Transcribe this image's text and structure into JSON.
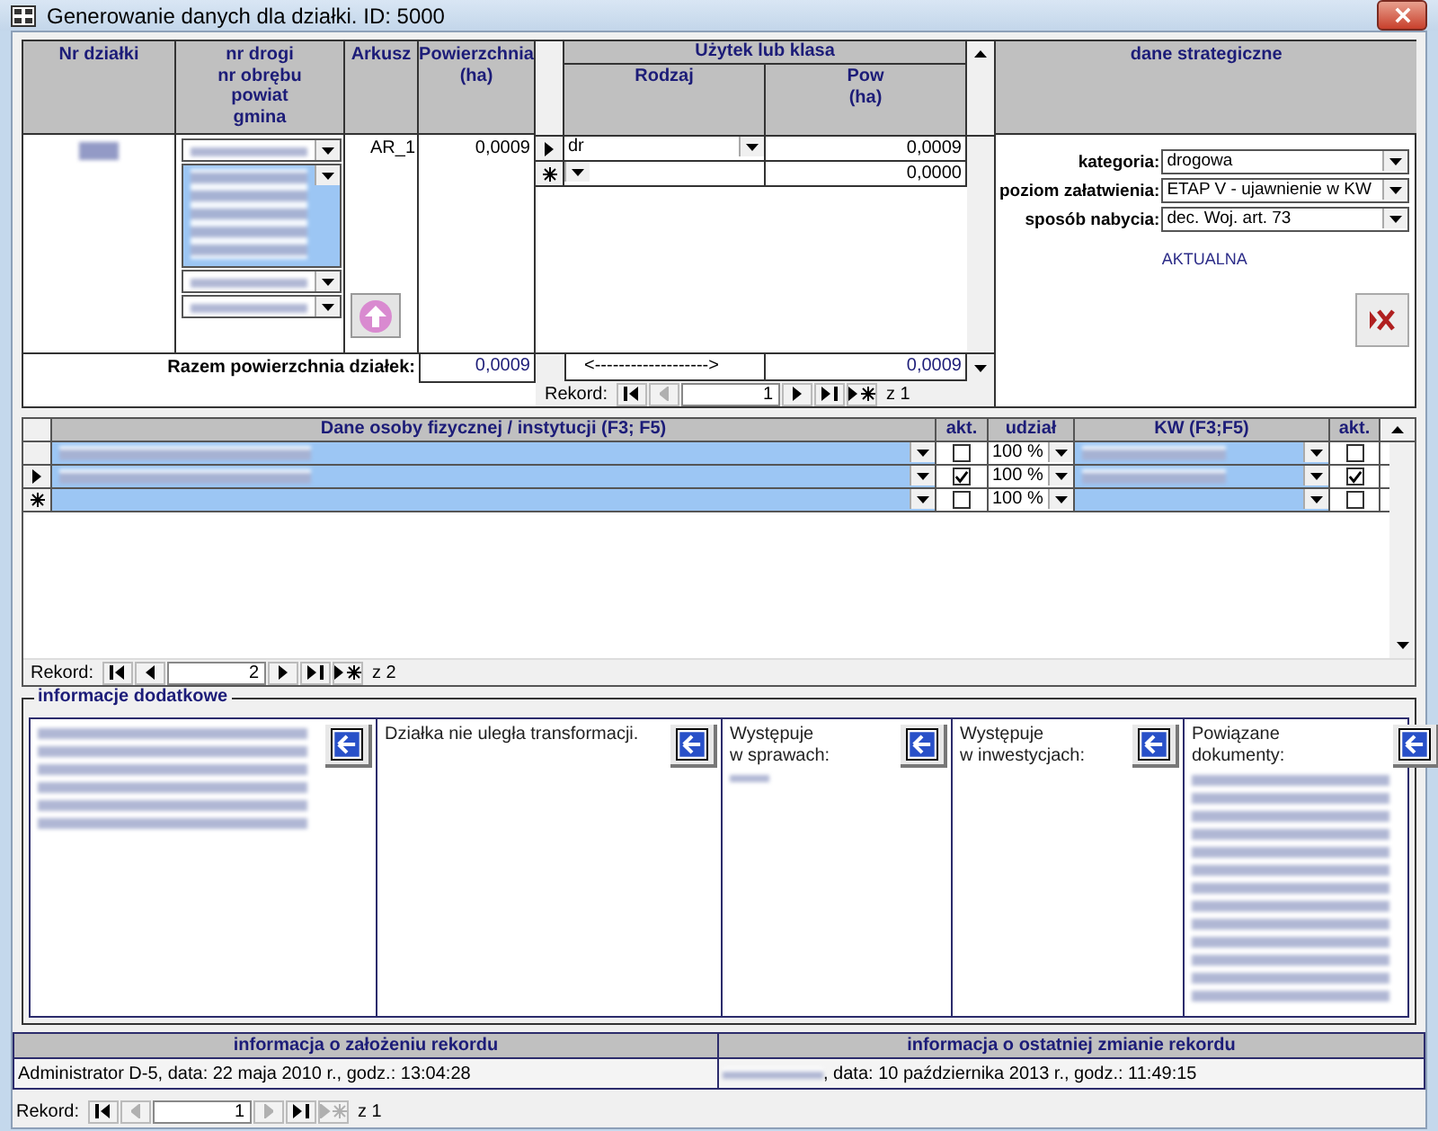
{
  "window": {
    "title": "Generowanie danych dla działki. ID: 5000"
  },
  "parcel": {
    "columns": [
      "Nr działki",
      "nr drogi\nnr obrębu\npowiat\ngmina",
      "Arkusz",
      "Powierzchnia\n(ha)"
    ],
    "number_redacted": true,
    "combos": [
      {
        "multiline": false,
        "selected": false
      },
      {
        "multiline": true,
        "selected": true
      },
      {
        "multiline": false,
        "selected": false
      },
      {
        "multiline": false,
        "selected": false
      }
    ],
    "arkusz": "AR_1",
    "area": "0,0009",
    "total": {
      "label": "Razem powierzchnia działek:",
      "value": "0,0009"
    }
  },
  "land_use": {
    "title": "Użytek lub klasa",
    "columns": [
      "Rodzaj",
      "Pow\n(ha)"
    ],
    "rows": [
      {
        "kind": "current",
        "rodzaj": "dr",
        "pow": "0,0009"
      },
      {
        "kind": "new",
        "pow": "0,0000"
      }
    ],
    "total_arrow": "<------------------->",
    "total": "0,0009",
    "nav": {
      "label": "Rekord:",
      "current": "1",
      "count": "z 1",
      "buttons": [
        {
          "kind": "first",
          "disabled": false
        },
        {
          "kind": "prev",
          "disabled": true
        },
        {
          "kind": "next",
          "disabled": false
        },
        {
          "kind": "last",
          "disabled": false
        },
        {
          "kind": "new",
          "disabled": false
        }
      ]
    }
  },
  "strategic": {
    "title": "dane strategiczne",
    "fields": [
      {
        "label": "kategoria:",
        "value": "drogowa"
      },
      {
        "label": "poziom załatwienia:",
        "value": "ETAP  V - ujawnienie w KW"
      },
      {
        "label": "sposób nabycia:",
        "value": "dec. Woj. art. 73"
      }
    ],
    "status": "AKTUALNA"
  },
  "persons": {
    "columns": [
      "Dane osoby fizycznej / instytucji (F3; F5)",
      "akt.",
      "udział",
      "KW (F3;F5)",
      "akt."
    ],
    "rows": [
      {
        "kind": "record",
        "redacted": true,
        "akt": false,
        "udzial": "100 %",
        "kw_akt": false
      },
      {
        "kind": "current",
        "redacted": true,
        "akt": true,
        "udzial": "100 %",
        "kw_akt": true
      },
      {
        "kind": "new",
        "redacted": false,
        "akt": false,
        "udzial": "100 %",
        "kw_akt": false
      }
    ],
    "nav": {
      "label": "Rekord:",
      "current": "2",
      "count": "z 2",
      "buttons": [
        {
          "kind": "first",
          "disabled": false
        },
        {
          "kind": "prev",
          "disabled": false
        },
        {
          "kind": "next",
          "disabled": false
        },
        {
          "kind": "last",
          "disabled": false
        },
        {
          "kind": "new",
          "disabled": false
        }
      ]
    }
  },
  "additional": {
    "title": "informacje dodatkowe",
    "panels": [
      {
        "redacted": true
      },
      {
        "text": "Działka nie uległa transformacji."
      },
      {
        "label": "Występuje\nw sprawach:",
        "redacted": true
      },
      {
        "label": "Występuje\nw inwestycjach:"
      },
      {
        "label": "Powiązane\ndokumenty:",
        "redacted": true
      }
    ]
  },
  "record_info": [
    {
      "title": "informacja o założeniu rekordu",
      "text": "Administrator D-5, data: 22 maja 2010 r., godz.: 13:04:28",
      "redacted_prefix": false
    },
    {
      "title": "informacja o ostatniej zmianie rekordu",
      "text": ", data: 10 października 2013 r., godz.: 11:49:15",
      "redacted_prefix": true
    }
  ],
  "nav": {
    "label": "Rekord:",
    "current": "1",
    "count": "z 1",
    "buttons": [
      {
        "kind": "first",
        "disabled": false
      },
      {
        "kind": "prev",
        "disabled": true
      },
      {
        "kind": "next",
        "disabled": true
      },
      {
        "kind": "last",
        "disabled": false
      },
      {
        "kind": "new",
        "disabled": true
      }
    ]
  }
}
